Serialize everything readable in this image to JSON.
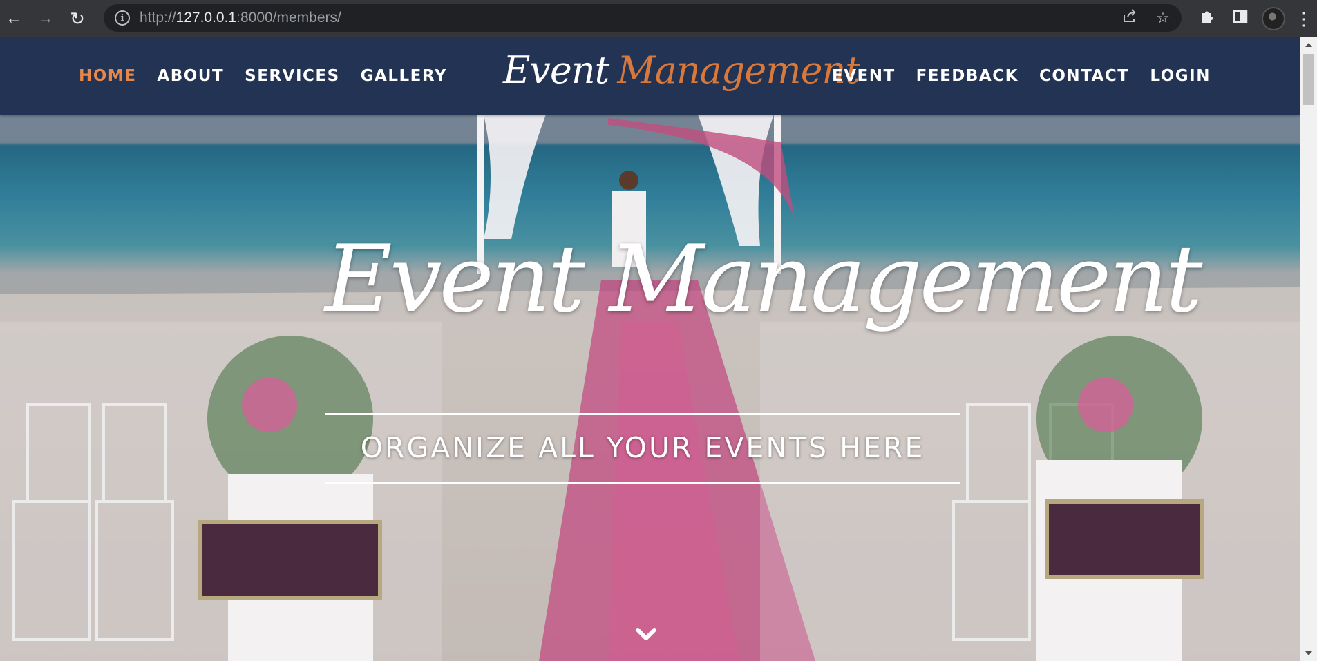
{
  "browser": {
    "url_scheme": "http://",
    "url_host": "127.0.0.1",
    "url_rest": ":8000/members/",
    "icons": {
      "back": "back-arrow-icon",
      "forward": "forward-arrow-icon",
      "reload": "reload-icon",
      "info": "info-icon",
      "share": "share-icon",
      "bookmark": "star-icon",
      "extensions": "puzzle-icon",
      "side_panel": "side-panel-icon",
      "menu": "kebab-menu-icon"
    }
  },
  "header": {
    "logo_part1": "Event",
    "logo_part2": "Management",
    "menu_left": [
      {
        "label": "HOME",
        "active": true
      },
      {
        "label": "ABOUT",
        "active": false
      },
      {
        "label": "SERVICES",
        "active": false
      },
      {
        "label": "GALLERY",
        "active": false
      }
    ],
    "menu_right": [
      {
        "label": "EVENT",
        "active": false
      },
      {
        "label": "FEEDBACK",
        "active": false
      },
      {
        "label": "CONTACT",
        "active": false
      },
      {
        "label": "LOGIN",
        "active": false
      }
    ],
    "colors": {
      "background": "#233354",
      "active": "#e8874a",
      "logo_accent": "#d8783a"
    }
  },
  "hero": {
    "title": "Event Management",
    "subtitle": "ORGANIZE ALL YOUR EVENTS HERE",
    "scroll_icon": "chevron-down-icon"
  }
}
